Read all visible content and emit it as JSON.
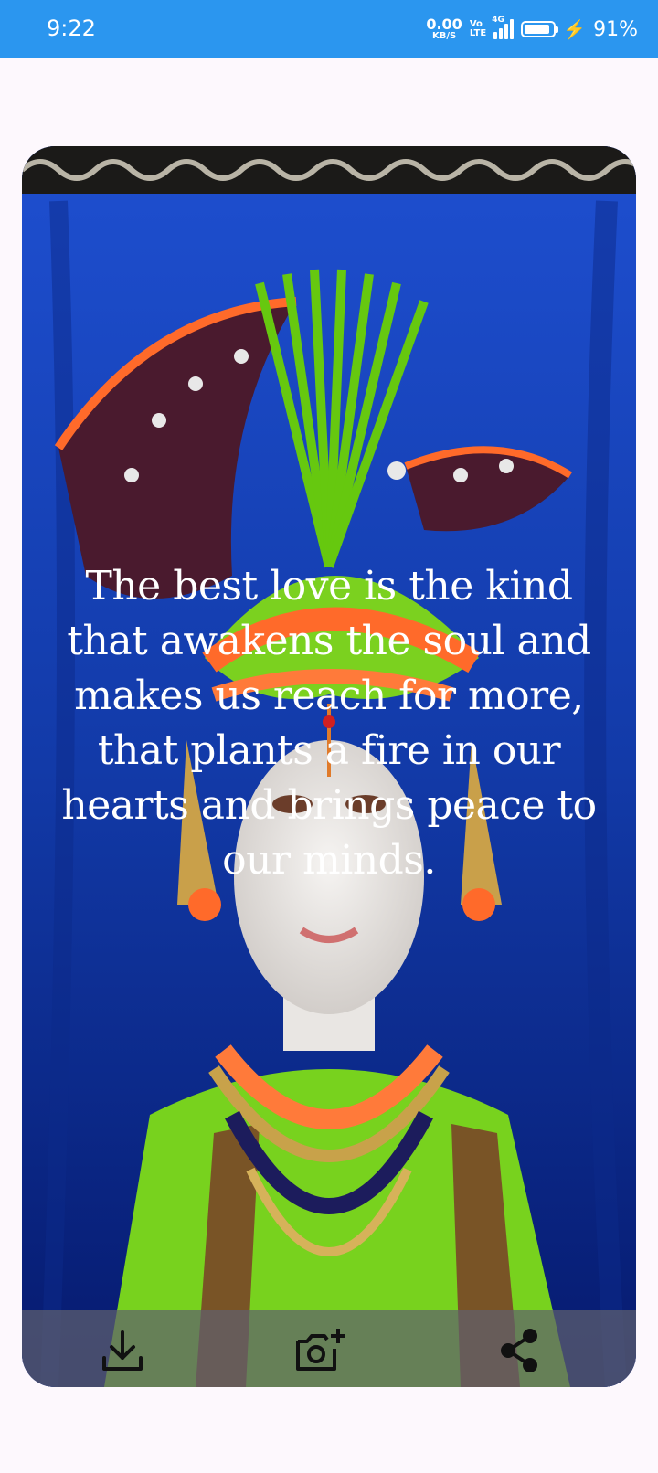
{
  "status_bar": {
    "time": "9:22",
    "net_speed_value": "0.00",
    "net_speed_unit": "KB/S",
    "volte_top": "Vo",
    "volte_bottom": "LTE",
    "network_type": "4G",
    "battery_percent": "91%",
    "battery_level": 0.91,
    "charging": true
  },
  "card": {
    "image_icon": "deity-image",
    "quote": "The best love is the kind that awakens the soul and makes us reach for more, that plants a fire in our hearts and brings peace to our minds."
  },
  "actions": {
    "download_icon": "download-icon",
    "add_photo_icon": "add-photo-icon",
    "share_icon": "share-icon"
  },
  "colors": {
    "status_bar": "#2b96ef",
    "background": "#fdf8fd",
    "action_bar": "#5f5f6e",
    "icon": "#111111"
  }
}
